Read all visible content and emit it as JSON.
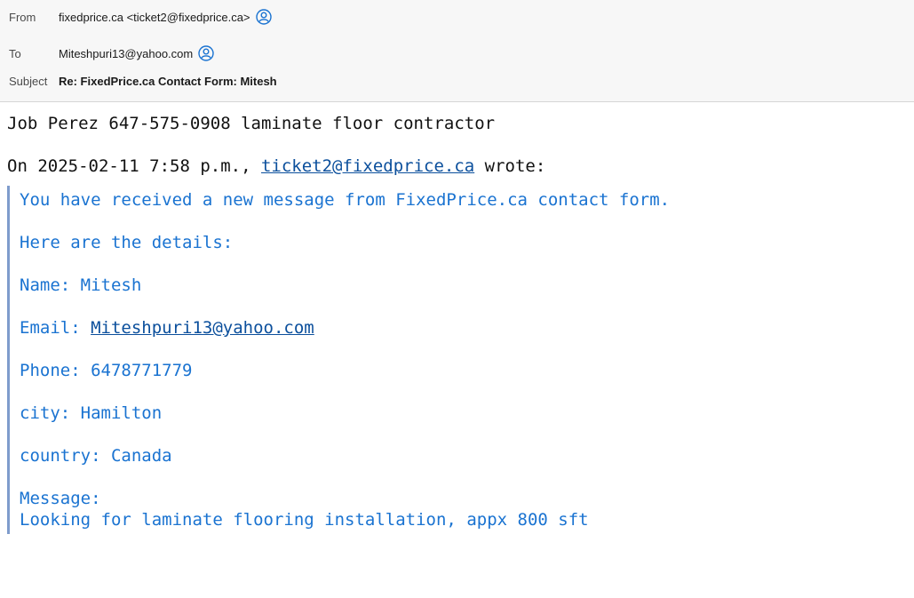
{
  "header": {
    "from_label": "From",
    "from_value": "fixedprice.ca <ticket2@fixedprice.ca>",
    "to_label": "To",
    "to_value": "Miteshpuri13@yahoo.com",
    "subject_label": "Subject",
    "subject_value": "Re: FixedPrice.ca Contact Form: Mitesh",
    "contact_icon": "person-circle-icon",
    "accent": "#1a73d1"
  },
  "message": {
    "reply_line": "Job Perez 647-575-0908 laminate floor contractor",
    "attribution_prefix": "On 2025-02-11 7:58 p.m., ",
    "attribution_email": "ticket2@fixedprice.ca",
    "attribution_suffix": " wrote:",
    "quoted": {
      "intro": "You have received a new message from FixedPrice.ca contact form.",
      "details_heading": "Here are the details:",
      "name_line": "Name: Mitesh",
      "email_prefix": "Email: ",
      "email_link": "Miteshpuri13@yahoo.com",
      "phone_line": "Phone: 6478771779",
      "city_line": "city: Hamilton",
      "country_line": "country: Canada",
      "message_label": "Message:",
      "message_text": "Looking for laminate flooring installation, appx 800 sft"
    },
    "quote_color": "#1a73d1"
  }
}
